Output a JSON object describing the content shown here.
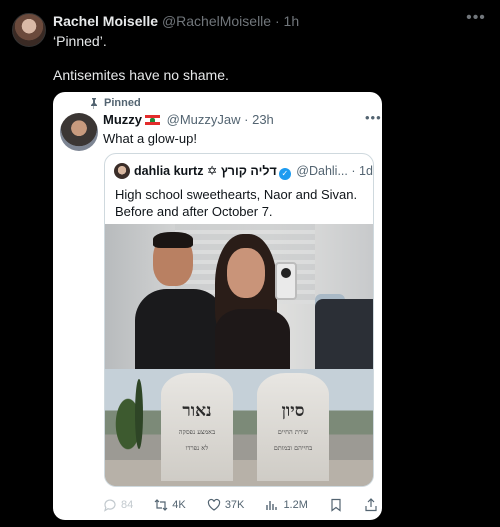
{
  "outer_post": {
    "display_name": "Rachel Moiselle",
    "handle": "@RachelMoiselle",
    "separator": "·",
    "time": "1h",
    "line1": "‘Pinned’.",
    "line2": "Antisemites have no shame."
  },
  "card": {
    "pinned_label": "Pinned",
    "display_name": "Muzzy",
    "handle": "@MuzzyJaw",
    "separator": "·",
    "time": "23h",
    "text": "What a glow-up!",
    "quote": {
      "display_name": "dahlia kurtz ✡ דליה קורץ",
      "handle": "@Dahli...",
      "separator": "·",
      "time": "1d",
      "text": "High school sweethearts, Naor and Sivan. Before and after October 7.",
      "grave_left": {
        "name": "נאור",
        "line1": "באמצע נפסקה",
        "line2": "לא נפרדו"
      },
      "grave_right": {
        "name": "סיון",
        "line1": "שירת החיים",
        "line2": "בחייהם ובמותם"
      }
    },
    "actions": {
      "replies": "84",
      "reposts": "4K",
      "likes": "37K",
      "views": "1.2M"
    }
  },
  "icons": {
    "more": "more-horizontal-icon",
    "pin": "pin-icon",
    "verified": "verified-badge-icon",
    "flag": "lebanon-flag-icon"
  },
  "colors": {
    "background": "#000000",
    "card": "#ffffff",
    "verified": "#1d9bf0",
    "muted": "#71767b"
  }
}
